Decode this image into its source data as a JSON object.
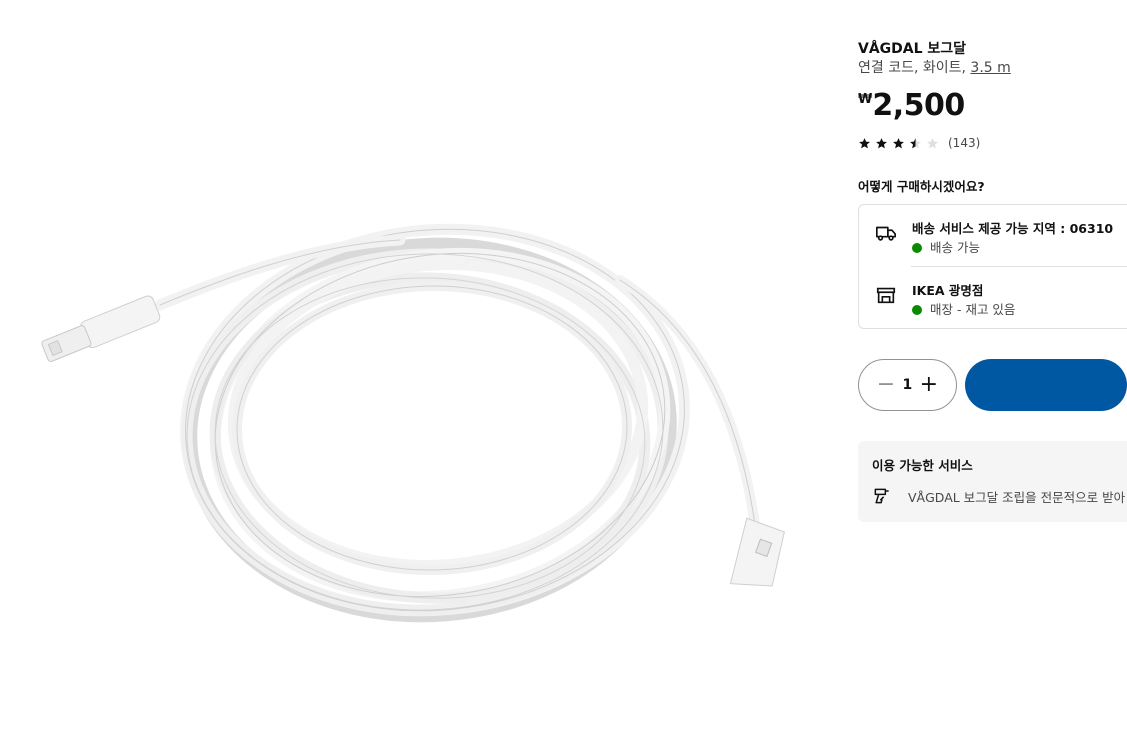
{
  "product": {
    "name": "VÅGDAL 보그달",
    "description": "연결 코드, 화이트, ",
    "length": "3.5 m",
    "currency_symbol": "₩",
    "price": "2,500",
    "rating_value": 3.5,
    "rating_max": 5,
    "review_count": "(143)"
  },
  "purchase": {
    "heading": "어떻게 구매하시겠어요?",
    "delivery": {
      "icon": "truck-icon",
      "title": "배송 서비스 제공 가능 지역 : 06310",
      "status": "배송 가능",
      "status_color": "#0a8a00"
    },
    "store": {
      "icon": "store-icon",
      "title": "IKEA 광명점",
      "status": "매장 - 재고 있음",
      "status_color": "#0a8a00"
    }
  },
  "cart": {
    "minus": "−",
    "quantity": "1",
    "plus": "+",
    "add_button_color": "#0058a3"
  },
  "services": {
    "heading": "이용 가능한 서비스",
    "assembly_text": "VÅGDAL 보그달 조립을 전문적으로 받아",
    "icon": "drill-icon"
  }
}
